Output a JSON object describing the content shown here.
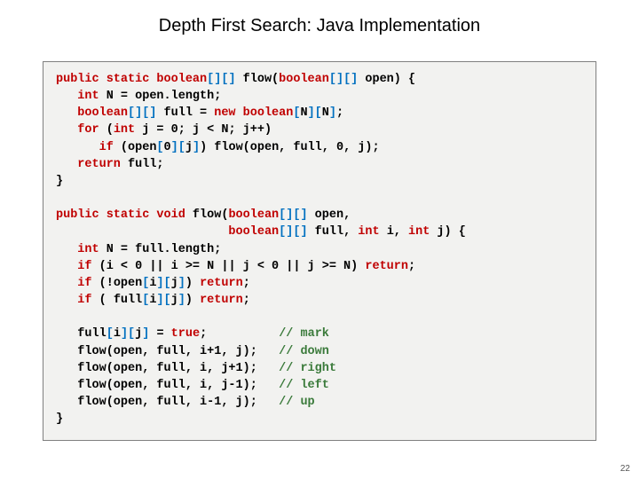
{
  "title": "Depth First Search:  Java Implementation",
  "page_number": "22",
  "code": {
    "l01a": "public static boolean",
    "l01b": "[][]",
    "l01c": " flow(",
    "l01d": "boolean",
    "l01e": "[][]",
    "l01f": " open) {",
    "l02a": "   int",
    "l02b": " N = open.length;",
    "l03a": "   boolean",
    "l03b": "[][]",
    "l03c": " full = ",
    "l03d": "new boolean",
    "l03e": "[",
    "l03f": "N",
    "l03g": "][",
    "l03h": "N",
    "l03i": "]",
    "l03j": ";",
    "l04a": "   for",
    "l04b": " (",
    "l04c": "int",
    "l04d": " j = 0; j < N; j++)",
    "l05a": "      if",
    "l05b": " (open",
    "l05c": "[",
    "l05d": "0",
    "l05e": "][",
    "l05f": "j",
    "l05g": "]",
    "l05h": ") flow(open, full, 0, j);",
    "l06a": "   return",
    "l06b": " full;",
    "l07": "}",
    "blank1": "",
    "l08a": "public static void",
    "l08b": " flow(",
    "l08c": "boolean",
    "l08d": "[][]",
    "l08e": " open,",
    "l09a": "                        boolean",
    "l09b": "[][]",
    "l09c": " full, ",
    "l09d": "int",
    "l09e": " i, ",
    "l09f": "int",
    "l09g": " j) {",
    "l10a": "   int",
    "l10b": " N = full.length;",
    "l11a": "   if",
    "l11b": " (i < 0 || i >= N || j < 0 || j >= N) ",
    "l11c": "return",
    "l11d": ";",
    "l12a": "   if",
    "l12b": " (!open",
    "l12c": "[",
    "l12d": "i",
    "l12e": "][",
    "l12f": "j",
    "l12g": "]",
    "l12h": ") ",
    "l12i": "return",
    "l12j": ";",
    "l13a": "   if",
    "l13b": " ( full",
    "l13c": "[",
    "l13d": "i",
    "l13e": "][",
    "l13f": "j",
    "l13g": "]",
    "l13h": ") ",
    "l13i": "return",
    "l13j": ";",
    "blank2": "",
    "l14a": "   full",
    "l14b": "[",
    "l14c": "i",
    "l14d": "][",
    "l14e": "j",
    "l14f": "]",
    "l14g": " = ",
    "l14h": "true",
    "l14i": ";          ",
    "l14j": "// mark",
    "l15a": "   flow(open, full, i+1, j);   ",
    "l15b": "// down",
    "l16a": "   flow(open, full, i, j+1);   ",
    "l16b": "// right",
    "l17a": "   flow(open, full, i, j-1);   ",
    "l17b": "// left",
    "l18a": "   flow(open, full, i-1, j);   ",
    "l18b": "// up",
    "l19": "}"
  }
}
